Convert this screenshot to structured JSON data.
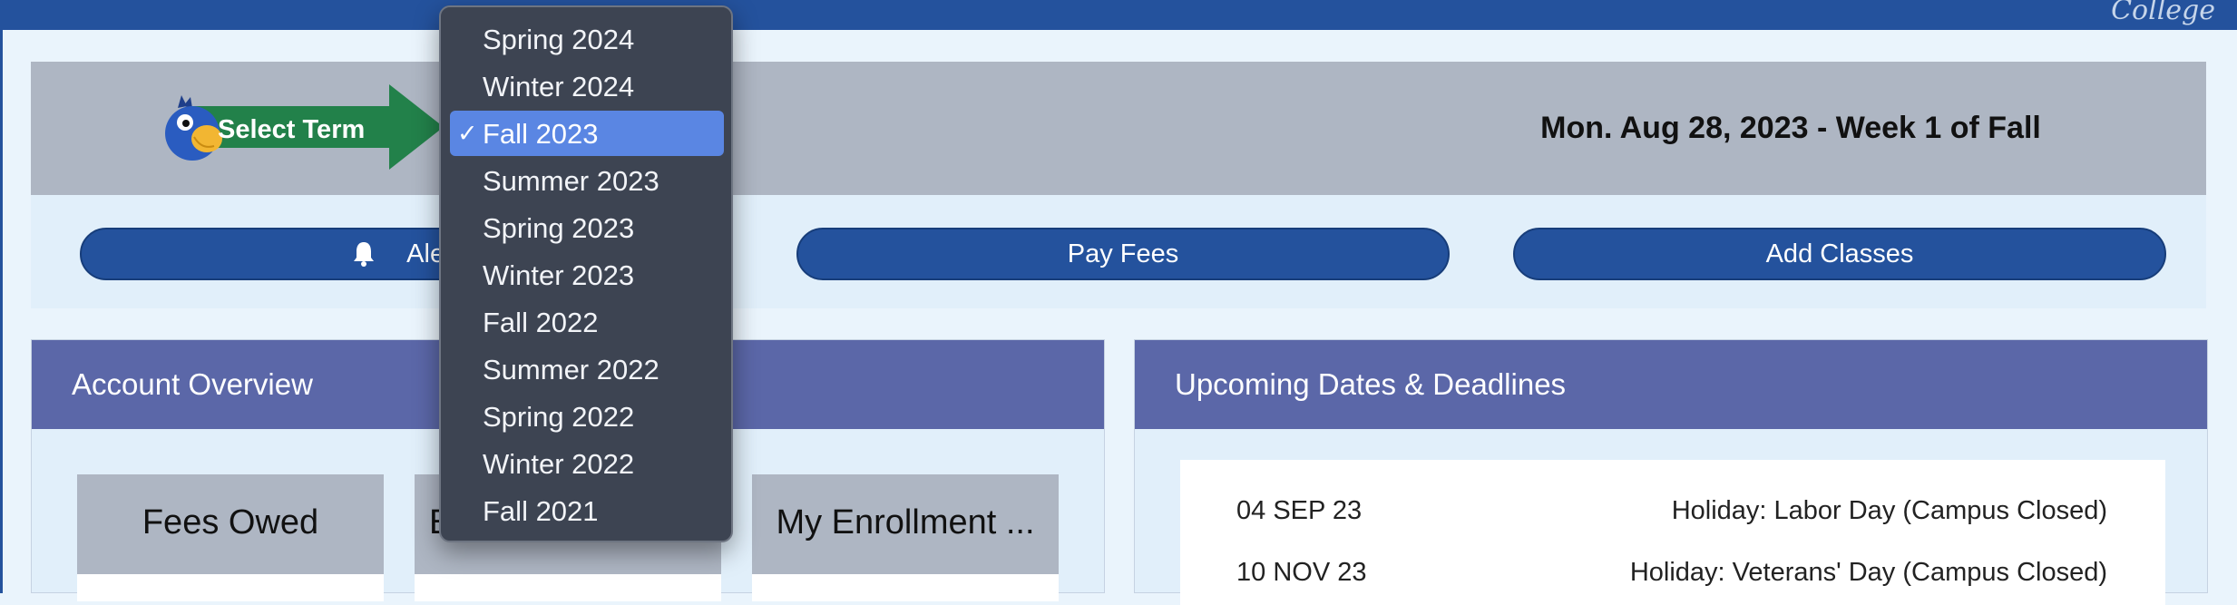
{
  "term_bar": {
    "select_term_label": "Select Term",
    "current_date": "Mon. Aug 28, 2023 - Week 1 of Fall"
  },
  "term_menu": {
    "options": [
      "Spring 2024",
      "Winter 2024",
      "Fall 2023",
      "Summer 2023",
      "Spring 2023",
      "Winter 2023",
      "Fall 2022",
      "Summer 2022",
      "Spring 2022",
      "Winter 2022",
      "Fall 2021"
    ],
    "selected": "Fall 2023",
    "check_glyph": "✓"
  },
  "actions": {
    "alert_label": "Alert",
    "pay_fees_label": "Pay Fees",
    "add_classes_label": "Add Classes"
  },
  "account_overview": {
    "title": "Account Overview",
    "cards": [
      "Fees Owed",
      "E",
      "My Enrollment ..."
    ]
  },
  "upcoming": {
    "title": "Upcoming Dates & Deadlines",
    "rows": [
      {
        "date": "04 SEP 23",
        "event": "Holiday: Labor Day (Campus Closed)"
      },
      {
        "date": "10 NOV 23",
        "event": "Holiday: Veterans' Day (Campus Closed)"
      }
    ]
  },
  "colors": {
    "brand_blue": "#24529d",
    "panel_header": "#5b67a8",
    "arrow_green": "#22814a",
    "menu_bg": "#3d4452",
    "menu_selected": "#5a86e3"
  }
}
